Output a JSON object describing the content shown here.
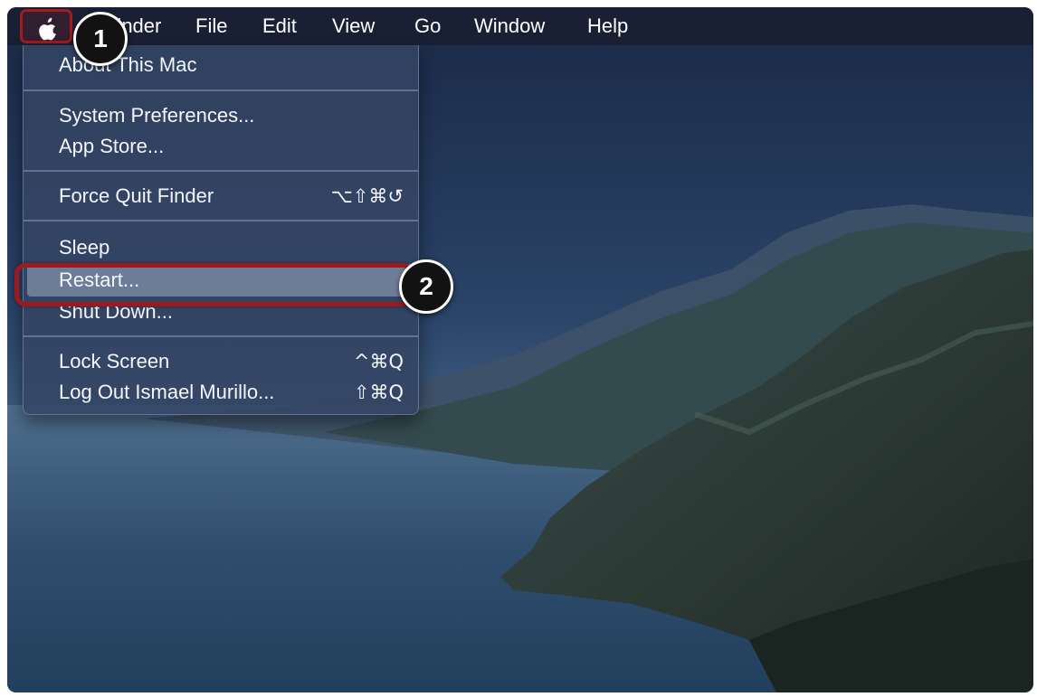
{
  "menubar": {
    "apple_icon": "apple-icon",
    "items": [
      "Finder",
      "File",
      "Edit",
      "View",
      "Go",
      "Window",
      "Help"
    ]
  },
  "apple_menu": {
    "about": "About This Mac",
    "system_preferences": "System Preferences...",
    "app_store": "App Store...",
    "force_quit": "Force Quit Finder",
    "force_quit_shortcut": "⌥⇧⌘↺",
    "sleep": "Sleep",
    "restart": "Restart...",
    "shut_down": "Shut Down...",
    "lock_screen": "Lock Screen",
    "lock_screen_shortcut": "^⌘Q",
    "log_out": "Log Out Ismael Murillo...",
    "log_out_shortcut": "⇧⌘Q"
  },
  "callouts": {
    "step1": "1",
    "step2": "2"
  },
  "colors": {
    "highlight_red": "#9c1a1e",
    "menu_bg": "#344564",
    "sky": "#1c2d49"
  }
}
